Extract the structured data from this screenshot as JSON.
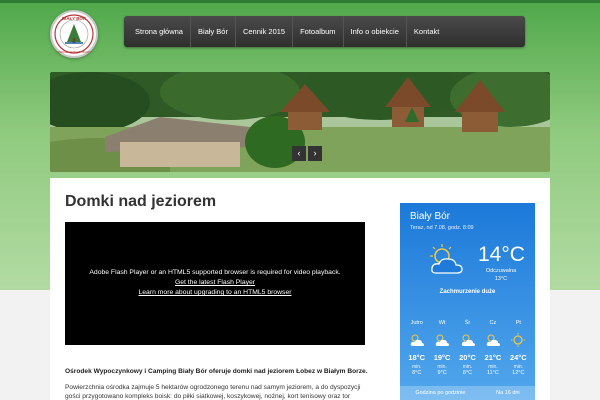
{
  "logo": {
    "text": "BIAŁY BÓR",
    "subtext": "OŚRODEK WYPOCZYNKOWY",
    "icon": "camping-logo"
  },
  "nav": {
    "items": [
      {
        "label": "Strona główna"
      },
      {
        "label": "Biały Bór"
      },
      {
        "label": "Cennik 2015"
      },
      {
        "label": "Fotoalbum"
      },
      {
        "label": "Info o obiekcie"
      },
      {
        "label": "Kontakt"
      }
    ]
  },
  "slider": {
    "prev_label": "‹",
    "next_label": "›"
  },
  "main": {
    "title": "Domki nad jeziorem",
    "video": {
      "message": "Adobe Flash Player or an HTML5 supported browser is required for video playback.",
      "link1": "Get the latest Flash Player",
      "link2": "Learn more about upgrading to an HTML5 browser"
    },
    "para1": "Ośrodek Wypoczynkowy i Camping Biały Bór oferuje domki nad jeziorem Łobez w Białym Borze.",
    "para2": "Powierzchnia ośrodka zajmuje 5 hektarów ogrodzonego terenu nad samym jeziorem, a do dyspozycji gości przygotowano kompleks boisk: do piłki siatkowej, koszykowej, nożnej, kort tenisowy oraz tor"
  },
  "weather": {
    "city": "Biały Bór",
    "date": "Teraz, nd 7.08, godz. 8:09",
    "temp": "14°C",
    "feel_label": "Odczuwalna",
    "feel_value": "13°C",
    "condition": "Zachmurzenie duże",
    "days": [
      {
        "name": "Jutro",
        "max": "18°C",
        "min_label": "min.",
        "min": "8°C"
      },
      {
        "name": "Wt",
        "max": "19°C",
        "min_label": "min.",
        "min": "9°C"
      },
      {
        "name": "Śr",
        "max": "20°C",
        "min_label": "min.",
        "min": "8°C"
      },
      {
        "name": "Cz",
        "max": "21°C",
        "min_label": "min.",
        "min": "11°C"
      },
      {
        "name": "Pt",
        "max": "24°C",
        "min_label": "min.",
        "min": "12°C"
      }
    ],
    "footer_left": "Godzina po godzinie",
    "footer_right": "Na 16 dni"
  }
}
